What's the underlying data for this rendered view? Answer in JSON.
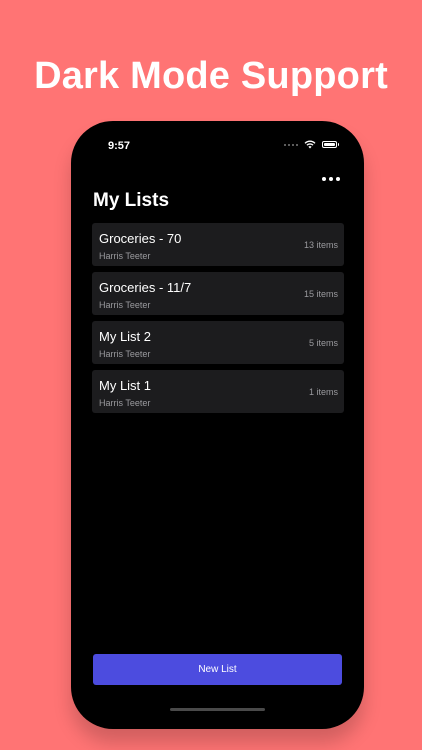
{
  "headline": "Dark Mode Support",
  "status_bar": {
    "time": "9:57"
  },
  "screen": {
    "title": "My Lists",
    "lists": [
      {
        "name": "Groceries - 70",
        "store": "Harris Teeter",
        "count": "13 items"
      },
      {
        "name": "Groceries - 11/7",
        "store": "Harris Teeter",
        "count": "15 items"
      },
      {
        "name": "My List 2",
        "store": "Harris Teeter",
        "count": "5 items"
      },
      {
        "name": "My List 1",
        "store": "Harris Teeter",
        "count": "1 items"
      }
    ],
    "new_list_label": "New List"
  },
  "icons": {
    "menu": "more-horizontal-icon",
    "wifi": "wifi-icon",
    "battery": "battery-icon",
    "signal": "signal-icon"
  },
  "colors": {
    "background": "#ff7474",
    "screen": "#000000",
    "card": "#1c1c1e",
    "accent": "#4c4cdf"
  }
}
